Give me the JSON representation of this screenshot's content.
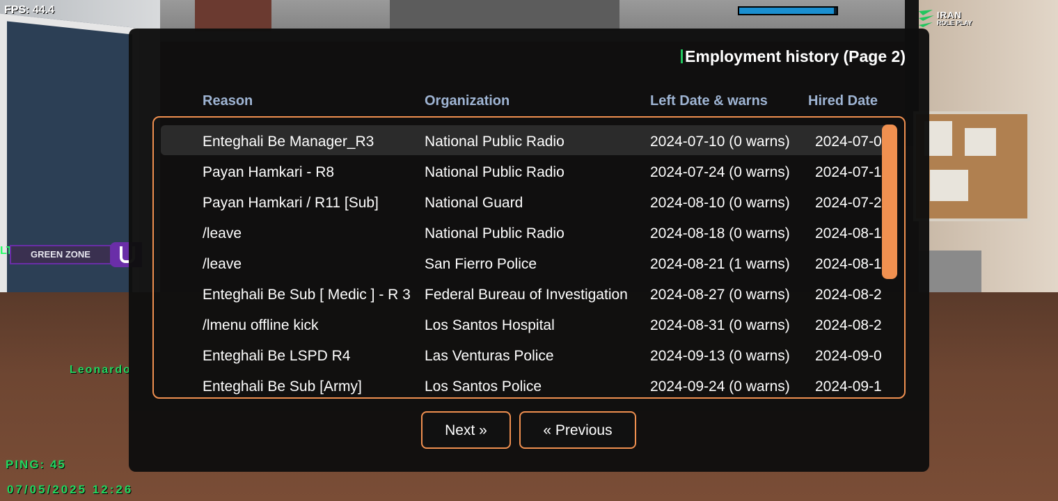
{
  "hud": {
    "fps": "FPS: 44.4",
    "health_fraction": 0.97,
    "logo_top": "IRAN",
    "logo_bottom": "ROLE PLAY",
    "zone_prefix": "LT'",
    "zone_label": "GREEN ZONE",
    "player_name": "Leonardo",
    "ping": "PING: 45",
    "datetime": "07/05/2025 12:26",
    "colors": {
      "hud_green": "#21d860",
      "health_blue": "#1a8fd0",
      "zone_purple": "#6a2ea8"
    }
  },
  "dialog": {
    "title": "Employment history (Page 2)",
    "columns": {
      "reason": "Reason",
      "organization": "Organization",
      "left": "Left Date & warns",
      "hired": "Hired Date"
    },
    "rows": [
      {
        "reason": "Enteghali Be Manager_R3",
        "organization": "National Public Radio",
        "left": "2024-07-10 (0 warns)",
        "hired": "2024-07-0"
      },
      {
        "reason": "Payan Hamkari - R8",
        "organization": "National Public Radio",
        "left": "2024-07-24 (0 warns)",
        "hired": "2024-07-1"
      },
      {
        "reason": "Payan Hamkari / R11 [Sub]",
        "organization": "National Guard",
        "left": "2024-08-10 (0 warns)",
        "hired": "2024-07-2"
      },
      {
        "reason": "/leave",
        "organization": "National Public Radio",
        "left": "2024-08-18 (0 warns)",
        "hired": "2024-08-1"
      },
      {
        "reason": "/leave",
        "organization": "San Fierro Police",
        "left": "2024-08-21 (1 warns)",
        "hired": "2024-08-1"
      },
      {
        "reason": "Enteghali Be Sub [ Medic ] - R 3",
        "organization": "Federal Bureau of Investigation",
        "left": "2024-08-27 (0 warns)",
        "hired": "2024-08-2"
      },
      {
        "reason": "/lmenu offline kick",
        "organization": "Los Santos Hospital",
        "left": "2024-08-31 (0 warns)",
        "hired": "2024-08-2"
      },
      {
        "reason": "Enteghali Be LSPD R4",
        "organization": "Las Venturas Police",
        "left": "2024-09-13 (0 warns)",
        "hired": "2024-09-0"
      },
      {
        "reason": "Enteghali Be Sub [Army]",
        "organization": "Los Santos Police",
        "left": "2024-09-24 (0 warns)",
        "hired": "2024-09-1"
      }
    ],
    "buttons": {
      "next": "Next »",
      "previous": "« Previous"
    },
    "colors": {
      "accent": "#f09050",
      "header_text": "#9fb5d4",
      "title_bar": "#22c55e"
    }
  }
}
